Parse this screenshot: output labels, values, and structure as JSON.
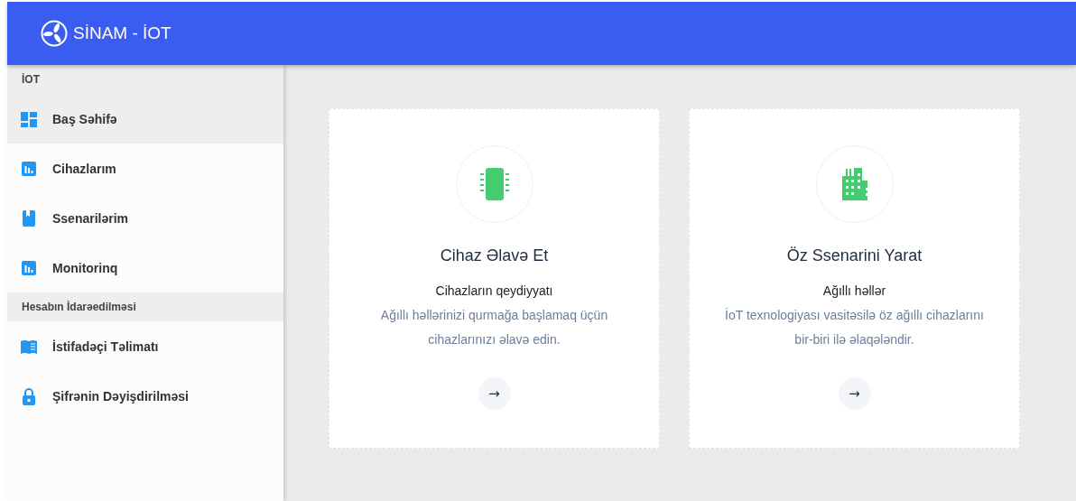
{
  "header": {
    "title": "SİNAM - İOT"
  },
  "sidebar": {
    "sections": [
      {
        "title": "İOT",
        "items": [
          {
            "label": "Baş Səhifə",
            "kind": "dashboard",
            "selected": true
          },
          {
            "label": "Cihazlarım",
            "kind": "chart",
            "selected": false
          },
          {
            "label": "Ssenarilərim",
            "kind": "bookmark",
            "selected": false
          },
          {
            "label": "Monitorinq",
            "kind": "chart",
            "selected": false
          }
        ]
      },
      {
        "title": "Hesabın İdarəedilməsi",
        "items": [
          {
            "label": "İstifadəçi Təlimatı",
            "kind": "book",
            "selected": false
          },
          {
            "label": "Şifrənin Dəyişdirilməsi",
            "kind": "lock",
            "selected": false
          }
        ]
      }
    ]
  },
  "cards": [
    {
      "kind": "chip",
      "title": "Cihaz Əlavə Et",
      "subtitle": "Cihazların qeydiyyatı",
      "description": "Ağıllı həllərinizi qurmağa başlamaq üçün cihazlarınızı əlavə edin.",
      "button": "→"
    },
    {
      "kind": "building",
      "title": "Öz Ssenarini Yarat",
      "subtitle": "Ağıllı həllər",
      "description": "İoT texnologiyası vasitəsilə öz ağıllı cihazlarını bir-biri ilə əlaqələndir.",
      "button": "→"
    }
  ]
}
